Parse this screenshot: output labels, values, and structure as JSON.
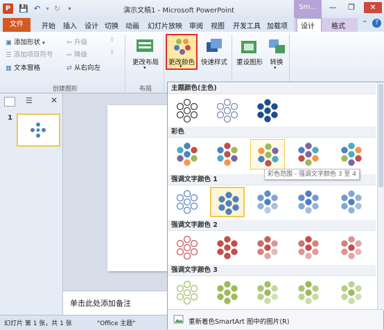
{
  "titlebar": {
    "app_icon": "P",
    "title": "演示文稿1 - Microsoft PowerPoint",
    "smartart_ctx": "Sm...",
    "qat_icons": [
      "save-icon",
      "undo-icon",
      "redo-icon"
    ],
    "window_buttons": [
      "minimize-icon",
      "restore-icon",
      "close-icon"
    ]
  },
  "tabs": {
    "file": "文件",
    "items": [
      "开始",
      "插入",
      "设计",
      "切换",
      "动画",
      "幻灯片放映",
      "审阅",
      "视图",
      "开发工具",
      "加载项"
    ],
    "context": [
      "设计",
      "格式"
    ]
  },
  "ribbon": {
    "create_graphic": {
      "add_shape": "添加形状",
      "add_bullet": "添加项目符号",
      "text_pane": "文本窗格",
      "promote": "升级",
      "demote": "降级",
      "right_to_left": "从右向左",
      "group_label": "创建图形"
    },
    "layouts": {
      "change_layout": "更改布局",
      "group_label": "布局"
    },
    "smartart_styles": {
      "change_colors": "更改颜色",
      "quick_styles": "快速样式"
    },
    "reset": {
      "reset_graphic": "重设图形",
      "convert": "转换"
    }
  },
  "slides_pane": {
    "slide_number": "1"
  },
  "notes": {
    "placeholder": "单击此处添加备注"
  },
  "status": {
    "slide_info": "幻灯片 第 1 张，共 1 张",
    "theme": "\"Office 主题\""
  },
  "gallery": {
    "sections": [
      {
        "title": "主题颜色(主色)",
        "cells": 3
      },
      {
        "title": "彩色",
        "cells": 5
      },
      {
        "title": "强调文字颜色 1",
        "cells": 5
      },
      {
        "title": "强调文字颜色 2",
        "cells": 5
      },
      {
        "title": "强调文字颜色 3",
        "cells": 5
      }
    ],
    "tooltip": "彩色范围 - 强调文字颜色 3 至 4",
    "footer_label": "重新着色SmartArt 图中的图片(R)",
    "colors": {
      "theme": [
        [
          "#ffffff",
          "#333333"
        ],
        [
          "#ffffff",
          "#6f84a4"
        ],
        [
          "#1f4e8a",
          "#1f4e8a"
        ]
      ],
      "colorful": [
        [
          "#4f81bd",
          "#c0504d",
          "#9bbb59",
          "#f79646",
          "#8064a2",
          "#4bacc6"
        ],
        [
          "#c0504d",
          "#9bbb59",
          "#8064a2",
          "#f79646",
          "#4bacc6",
          "#4f81bd"
        ],
        [
          "#9bbb59",
          "#8064a2",
          "#4bacc6",
          "#c0504d",
          "#4f81bd",
          "#f79646"
        ],
        [
          "#8064a2",
          "#4bacc6",
          "#f79646",
          "#9bbb59",
          "#c0504d",
          "#4f81bd"
        ],
        [
          "#4bacc6",
          "#f79646",
          "#c0504d",
          "#8064a2",
          "#9bbb59",
          "#4f81bd"
        ]
      ],
      "accent1": [
        "#4f81bd",
        "#4f81bd",
        "#4f81bd",
        "#4f81bd",
        "#4f81bd"
      ],
      "accent2": [
        "#c0504d",
        "#c0504d",
        "#c0504d",
        "#c0504d",
        "#c0504d"
      ],
      "accent3": [
        "#9bbb59",
        "#9bbb59",
        "#9bbb59",
        "#9bbb59",
        "#9bbb59"
      ]
    }
  }
}
